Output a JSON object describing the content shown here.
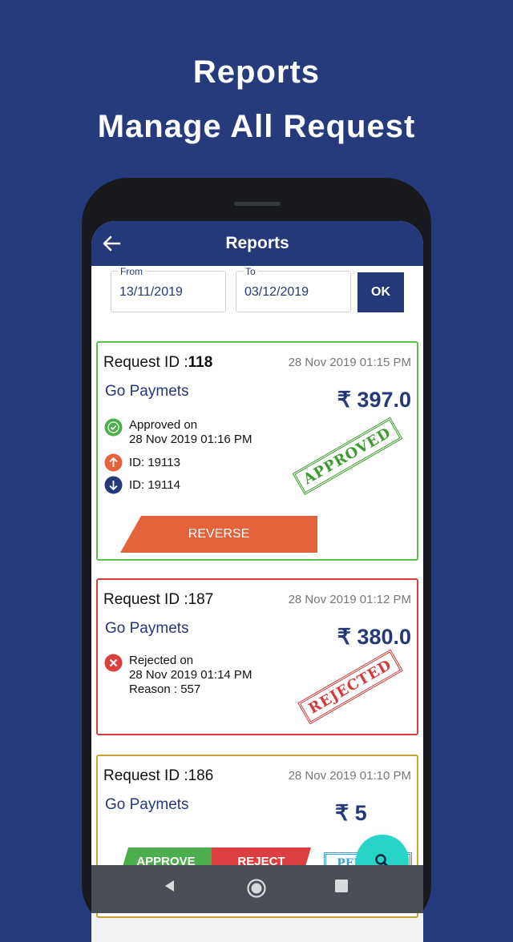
{
  "promo": {
    "line1": "Reports",
    "line2": "Manage All Request"
  },
  "appbar": {
    "title": "Reports"
  },
  "filters": {
    "from_label": "From",
    "from_value": "13/11/2019",
    "to_label": "To",
    "to_value": "03/12/2019",
    "ok_label": "OK"
  },
  "requests": [
    {
      "id_label": "Request ID :",
      "id": "118",
      "datetime": "28 Nov 2019 01:15 PM",
      "provider": "Go Paymets",
      "amount": "₹ 397.0",
      "status_text": "Approved on",
      "status_time": "28 Nov 2019 01:16 PM",
      "from_id": "ID: 19113",
      "to_id": "ID: 19114",
      "stamp": "APPROVED",
      "action_label": "REVERSE",
      "border_color": "#5cbf4e"
    },
    {
      "id_label": "Request ID :",
      "id": "187",
      "datetime": "28 Nov 2019 01:12 PM",
      "provider": "Go Paymets",
      "amount": "₹ 380.0",
      "status_text": "Rejected on",
      "status_time": "28 Nov 2019 01:14 PM",
      "reason": "Reason : 557",
      "stamp": "REJECTED",
      "border_color": "#dc3f3f"
    },
    {
      "id_label": "Request ID :",
      "id": "186",
      "datetime": "28 Nov 2019 01:10 PM",
      "provider": "Go Paymets",
      "amount": "₹ 5",
      "approve_label": "APPROVE",
      "reject_label": "REJECT",
      "stamp": "PENDING",
      "border_color": "#c7a235"
    }
  ],
  "fab": {
    "icon": "search-icon"
  },
  "colors": {
    "background": "#263a7c",
    "appbar": "#25397a",
    "approved": "#5cbf4e",
    "rejected": "#dc3f3f",
    "pending": "#c7a235",
    "reverse": "#e4633a",
    "fab": "#27d5c8"
  }
}
